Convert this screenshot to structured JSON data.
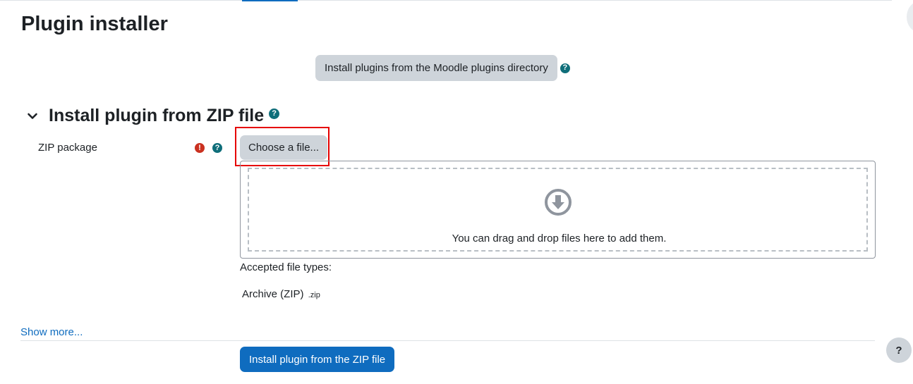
{
  "page": {
    "title": "Plugin installer"
  },
  "directory": {
    "button_label": "Install plugins from the Moodle plugins directory",
    "help_glyph": "?"
  },
  "zip_section": {
    "title": "Install plugin from ZIP file",
    "help_glyph": "?",
    "field_label": "ZIP package",
    "required_glyph": "!",
    "field_help_glyph": "?",
    "choose_button_label": "Choose a file...",
    "dropzone_text": "You can drag and drop files here to add them.",
    "accepted_label": "Accepted file types:",
    "file_type_name": "Archive (ZIP)",
    "file_type_ext": ".zip",
    "show_more": "Show more...",
    "submit_label": "Install plugin from the ZIP file"
  },
  "footer": {
    "help_glyph": "?"
  },
  "icons": {
    "collapse": "chevron-down-icon",
    "help": "question-circle-icon",
    "required": "exclamation-circle-icon",
    "dropzone": "arrow-circle-down-icon"
  },
  "colors": {
    "primary": "#0f6cbf",
    "secondary_button": "#ced4da",
    "help_icon": "#0f6e7a",
    "required_icon": "#ca3120",
    "highlight": "#e60000",
    "text": "#1d2125"
  }
}
